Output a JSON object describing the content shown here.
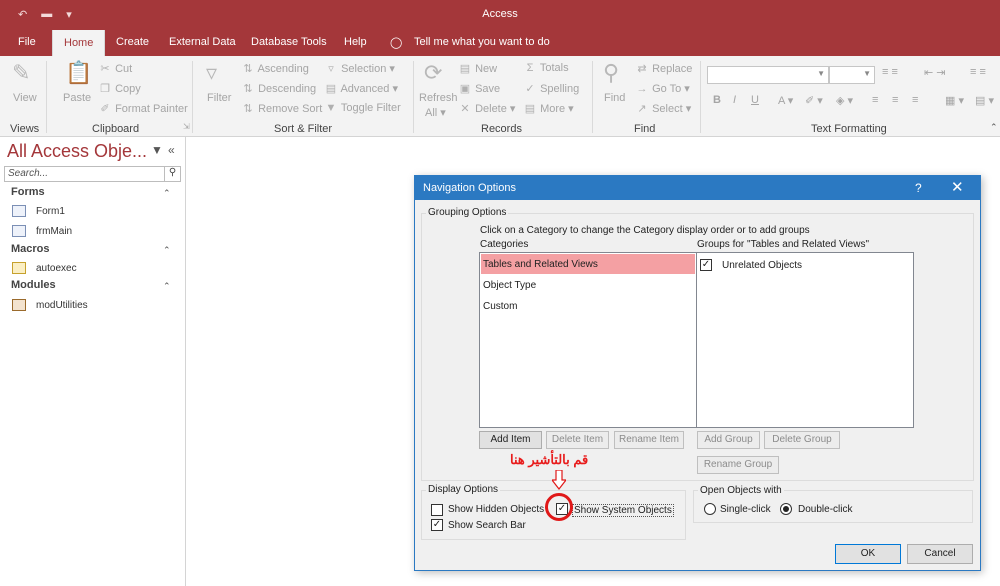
{
  "window": {
    "title": "Access"
  },
  "qat": {
    "undo": "↶",
    "open": "▬",
    "customize": "▾"
  },
  "tabs": [
    "File",
    "Home",
    "Create",
    "External Data",
    "Database Tools",
    "Help"
  ],
  "tell_me": "Tell me what you want to do",
  "ribbon": {
    "views": {
      "view": "View",
      "group": "Views"
    },
    "clipboard": {
      "paste": "Paste",
      "cut": "Cut",
      "copy": "Copy",
      "format_painter": "Format Painter",
      "group": "Clipboard"
    },
    "sort_filter": {
      "filter": "Filter",
      "ascending": "Ascending",
      "descending": "Descending",
      "remove_sort": "Remove Sort",
      "selection": "Selection",
      "advanced": "Advanced",
      "toggle_filter": "Toggle Filter",
      "group": "Sort & Filter"
    },
    "records": {
      "refresh": "Refresh",
      "all": "All",
      "new": "New",
      "save": "Save",
      "delete": "Delete",
      "totals": "Totals",
      "spelling": "Spelling",
      "more": "More",
      "group": "Records"
    },
    "find": {
      "find": "Find",
      "replace": "Replace",
      "goto": "Go To",
      "select": "Select",
      "group": "Find"
    },
    "text_formatting": {
      "group": "Text Formatting",
      "bold": "B",
      "italic": "I",
      "underline": "U"
    }
  },
  "nav": {
    "title": "All Access Obje...",
    "search_placeholder": "Search...",
    "groups": [
      {
        "label": "Forms",
        "items": [
          "Form1",
          "frmMain"
        ]
      },
      {
        "label": "Macros",
        "items": [
          "autoexec"
        ]
      },
      {
        "label": "Modules",
        "items": [
          "modUtilities"
        ]
      }
    ]
  },
  "dialog": {
    "title": "Navigation Options",
    "help": "?",
    "close": "✕",
    "grouping_legend": "Grouping Options",
    "instruction": "Click on a Category to change the Category display order or to add groups",
    "categories_label": "Categories",
    "groups_label": "Groups for \"Tables and Related Views\"",
    "categories": [
      "Tables and Related Views",
      "Object Type",
      "Custom"
    ],
    "groups": [
      {
        "label": "Unrelated Objects",
        "checked": true
      }
    ],
    "buttons": {
      "add_item": "Add Item",
      "delete_item": "Delete Item",
      "rename_item": "Rename Item",
      "add_group": "Add Group",
      "delete_group": "Delete Group",
      "rename_group": "Rename Group",
      "ok": "OK",
      "cancel": "Cancel"
    },
    "display_legend": "Display Options",
    "show_hidden": "Show Hidden Objects",
    "show_system": "Show System Objects",
    "show_search": "Show Search Bar",
    "open_legend": "Open Objects with",
    "single_click": "Single-click",
    "double_click": "Double-click",
    "state": {
      "show_hidden": false,
      "show_system": true,
      "show_search": true,
      "open_with": "double-click"
    }
  },
  "annotation": {
    "text": "قم بالتأشير هنا",
    "color": "#e81c1c"
  },
  "colors": {
    "accent": "#a4373a",
    "dialog_title": "#2b79c2",
    "selection": "#f4a0a3"
  }
}
